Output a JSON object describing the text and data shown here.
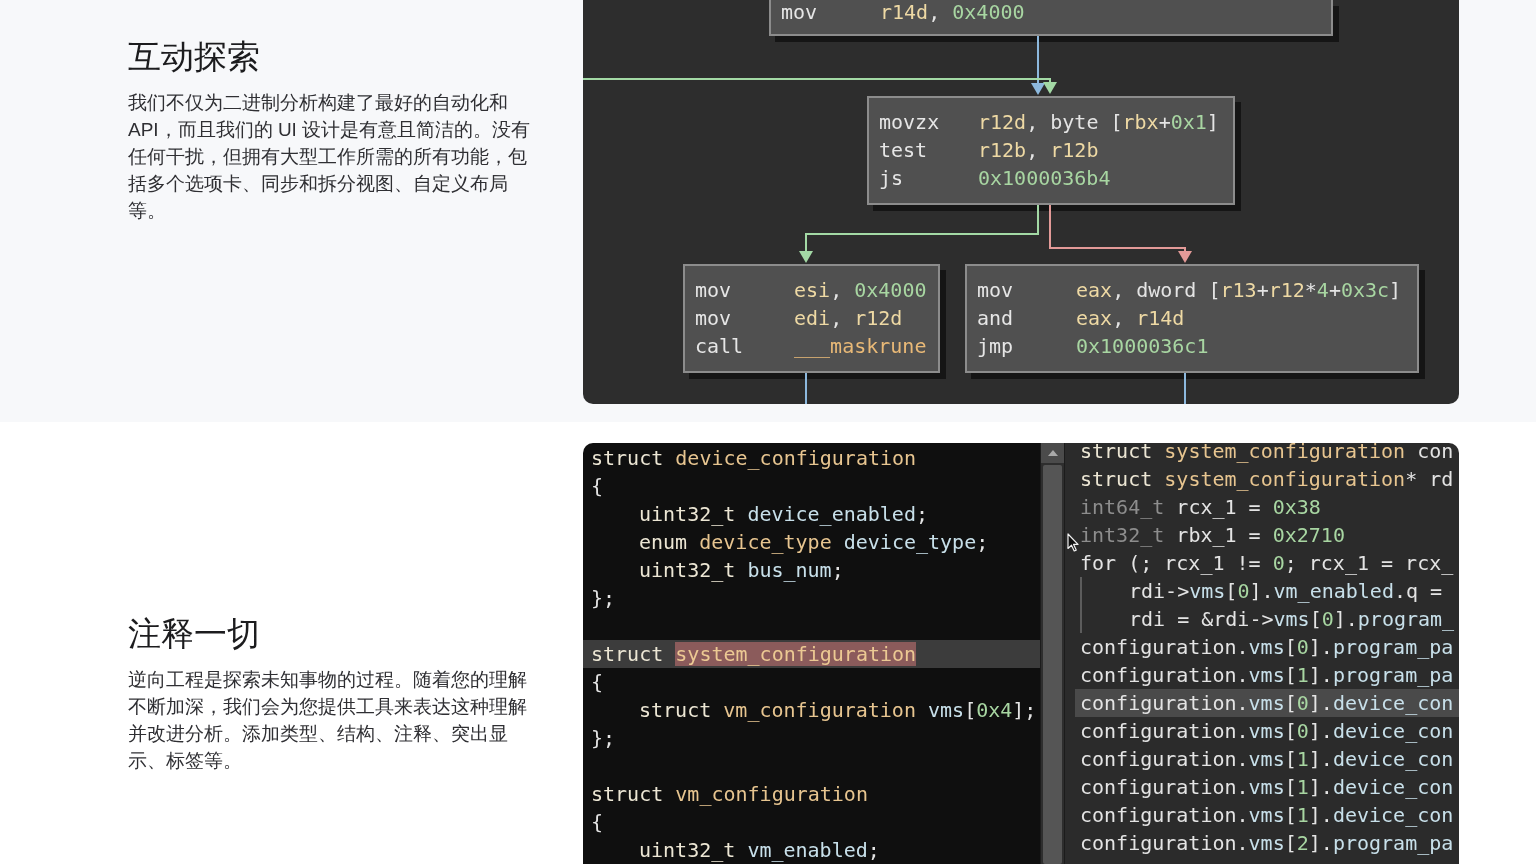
{
  "graph_section": {
    "heading": "互动探索",
    "description": "我们不仅为二进制分析构建了最好的自动化和API，而且我们的 UI 设计是有意且简洁的。没有任何干扰，但拥有大型工作所需的所有功能，包括多个选项卡、同步和拆分视图、自定义布局等。",
    "graph": {
      "blocks": [
        {
          "lines": [
            {
              "mnemonic": "mov",
              "operands": [
                {
                  "text": "r14d",
                  "kind": "register"
                },
                {
                  "text": ", ",
                  "kind": "plain"
                },
                {
                  "text": "0x4000",
                  "kind": "number"
                }
              ]
            }
          ]
        },
        {
          "lines": [
            {
              "mnemonic": "movzx",
              "operands": [
                {
                  "text": "r12d",
                  "kind": "register"
                },
                {
                  "text": ", byte [",
                  "kind": "plain"
                },
                {
                  "text": "rbx",
                  "kind": "register"
                },
                {
                  "text": "+",
                  "kind": "plain"
                },
                {
                  "text": "0x1",
                  "kind": "number"
                },
                {
                  "text": "]",
                  "kind": "plain"
                }
              ]
            },
            {
              "mnemonic": "test",
              "operands": [
                {
                  "text": "r12b",
                  "kind": "register"
                },
                {
                  "text": ", ",
                  "kind": "plain"
                },
                {
                  "text": "r12b",
                  "kind": "register"
                }
              ]
            },
            {
              "mnemonic": "js",
              "operands": [
                {
                  "text": "0x1000036b4",
                  "kind": "number"
                }
              ]
            }
          ]
        },
        {
          "lines": [
            {
              "mnemonic": "mov",
              "operands": [
                {
                  "text": "esi",
                  "kind": "register"
                },
                {
                  "text": ", ",
                  "kind": "plain"
                },
                {
                  "text": "0x4000",
                  "kind": "number"
                }
              ]
            },
            {
              "mnemonic": "mov",
              "operands": [
                {
                  "text": "edi",
                  "kind": "register"
                },
                {
                  "text": ", ",
                  "kind": "plain"
                },
                {
                  "text": "r12d",
                  "kind": "register"
                }
              ]
            },
            {
              "mnemonic": "call",
              "operands": [
                {
                  "text": "___maskrune",
                  "kind": "symbol"
                }
              ]
            }
          ]
        },
        {
          "lines": [
            {
              "mnemonic": "mov",
              "operands": [
                {
                  "text": "eax",
                  "kind": "register"
                },
                {
                  "text": ", dword [",
                  "kind": "plain"
                },
                {
                  "text": "r13",
                  "kind": "register"
                },
                {
                  "text": "+",
                  "kind": "plain"
                },
                {
                  "text": "r12",
                  "kind": "register"
                },
                {
                  "text": "*",
                  "kind": "plain"
                },
                {
                  "text": "4",
                  "kind": "number"
                },
                {
                  "text": "+",
                  "kind": "plain"
                },
                {
                  "text": "0x3c",
                  "kind": "number"
                },
                {
                  "text": "]",
                  "kind": "plain"
                }
              ]
            },
            {
              "mnemonic": "and",
              "operands": [
                {
                  "text": "eax",
                  "kind": "register"
                },
                {
                  "text": ", ",
                  "kind": "plain"
                },
                {
                  "text": "r14d",
                  "kind": "register"
                }
              ]
            },
            {
              "mnemonic": "jmp",
              "operands": [
                {
                  "text": "0x1000036c1",
                  "kind": "number"
                }
              ]
            }
          ]
        }
      ],
      "edges": [
        {
          "color": "#8db9de"
        },
        {
          "color": "#a3d9a5"
        },
        {
          "color": "#a3d9a5"
        },
        {
          "color": "#e39a98"
        },
        {
          "color": "#8db9de"
        },
        {
          "color": "#8db9de"
        }
      ]
    }
  },
  "types_section": {
    "heading": "注释一切",
    "description": "逆向工程是探索未知事物的过程。随着您的理解不断加深，我们会为您提供工具来表达这种理解并改进分析。添加类型、结构、注释、突出显示、标签等。",
    "types_pane": {
      "lines": [
        {
          "kind": "code",
          "selected": false,
          "tokens": [
            {
              "text": "struct ",
              "kind": "keyword"
            },
            {
              "text": "device_configuration",
              "kind": "type"
            }
          ]
        },
        {
          "kind": "code",
          "selected": false,
          "tokens": [
            {
              "text": "{",
              "kind": "plain"
            }
          ],
          "children": [
            {
              "kind": "code",
              "selected": false,
              "tokens": [
                {
                  "text": "uint32_t ",
                  "kind": "keyword"
                },
                {
                  "text": "device_enabled",
                  "kind": "field"
                },
                {
                  "text": ";",
                  "kind": "plain"
                }
              ]
            },
            {
              "kind": "code",
              "selected": false,
              "tokens": [
                {
                  "text": "enum ",
                  "kind": "keyword"
                },
                {
                  "text": "device_type ",
                  "kind": "type"
                },
                {
                  "text": "device_type",
                  "kind": "field"
                },
                {
                  "text": ";",
                  "kind": "plain"
                }
              ]
            },
            {
              "kind": "code",
              "selected": false,
              "tokens": [
                {
                  "text": "uint32_t ",
                  "kind": "keyword"
                },
                {
                  "text": "bus_num",
                  "kind": "field"
                },
                {
                  "text": ";",
                  "kind": "plain"
                }
              ]
            }
          ]
        },
        {
          "kind": "code",
          "selected": false,
          "tokens": [
            {
              "text": "};",
              "kind": "plain"
            }
          ]
        },
        {
          "kind": "blank",
          "selected": false
        },
        {
          "kind": "code",
          "selected": true,
          "tokens": [
            {
              "text": "struct ",
              "kind": "keyword"
            },
            {
              "text": "system_configuration",
              "kind": "match"
            }
          ]
        },
        {
          "kind": "code",
          "selected": false,
          "tokens": [
            {
              "text": "{",
              "kind": "plain"
            }
          ],
          "children": [
            {
              "kind": "code",
              "selected": false,
              "tokens": [
                {
                  "text": "struct ",
                  "kind": "keyword"
                },
                {
                  "text": "vm_configuration ",
                  "kind": "type"
                },
                {
                  "text": "vms",
                  "kind": "field"
                },
                {
                  "text": "[",
                  "kind": "plain"
                },
                {
                  "text": "0x4",
                  "kind": "number"
                },
                {
                  "text": "];",
                  "kind": "plain"
                }
              ]
            }
          ]
        },
        {
          "kind": "code",
          "selected": false,
          "tokens": [
            {
              "text": "};",
              "kind": "plain"
            }
          ]
        },
        {
          "kind": "blank",
          "selected": false
        },
        {
          "kind": "code",
          "selected": false,
          "tokens": [
            {
              "text": "struct ",
              "kind": "keyword"
            },
            {
              "text": "vm_configuration",
              "kind": "type"
            }
          ]
        },
        {
          "kind": "code",
          "selected": false,
          "tokens": [
            {
              "text": "{",
              "kind": "plain"
            }
          ],
          "children": [
            {
              "kind": "code",
              "selected": false,
              "tokens": [
                {
                  "text": "uint32_t ",
                  "kind": "keyword"
                },
                {
                  "text": "vm_enabled",
                  "kind": "field"
                },
                {
                  "text": ";",
                  "kind": "plain"
                }
              ]
            }
          ]
        }
      ]
    },
    "code_pane": {
      "indent_guides": true,
      "lines": [
        {
          "kind": "code",
          "selected": false,
          "tokens": [
            {
              "text": "struct ",
              "kind": "keyword"
            },
            {
              "text": "system_configuration",
              "kind": "type"
            },
            {
              "text": " con",
              "kind": "plain"
            }
          ]
        },
        {
          "kind": "code",
          "selected": false,
          "tokens": [
            {
              "text": "struct ",
              "kind": "keyword"
            },
            {
              "text": "system_configuration",
              "kind": "type"
            },
            {
              "text": "* rd",
              "kind": "plain"
            }
          ]
        },
        {
          "kind": "code",
          "selected": false,
          "tokens": [
            {
              "text": "int64_t",
              "kind": "dim"
            },
            {
              "text": " rcx_1 = ",
              "kind": "plain"
            },
            {
              "text": "0x38",
              "kind": "number"
            }
          ]
        },
        {
          "kind": "code",
          "selected": false,
          "tokens": [
            {
              "text": "int32_t",
              "kind": "dim"
            },
            {
              "text": " rbx_1 = ",
              "kind": "plain"
            },
            {
              "text": "0x2710",
              "kind": "number"
            }
          ]
        },
        {
          "kind": "code",
          "selected": false,
          "tokens": [
            {
              "text": "for (; rcx_1 != ",
              "kind": "plain"
            },
            {
              "text": "0",
              "kind": "number"
            },
            {
              "text": "; rcx_1 = rcx_",
              "kind": "plain"
            }
          ],
          "children": [
            {
              "kind": "code",
              "selected": false,
              "tokens": [
                {
                  "text": "rdi->",
                  "kind": "plain"
                },
                {
                  "text": "vms",
                  "kind": "field"
                },
                {
                  "text": "[",
                  "kind": "plain"
                },
                {
                  "text": "0",
                  "kind": "number"
                },
                {
                  "text": "].",
                  "kind": "plain"
                },
                {
                  "text": "vm_enabled",
                  "kind": "field"
                },
                {
                  "text": ".q =",
                  "kind": "plain"
                }
              ]
            },
            {
              "kind": "code",
              "selected": false,
              "tokens": [
                {
                  "text": "rdi = &rdi->",
                  "kind": "plain"
                },
                {
                  "text": "vms",
                  "kind": "field"
                },
                {
                  "text": "[",
                  "kind": "plain"
                },
                {
                  "text": "0",
                  "kind": "number"
                },
                {
                  "text": "].",
                  "kind": "plain"
                },
                {
                  "text": "program_",
                  "kind": "field"
                }
              ]
            }
          ]
        },
        {
          "kind": "code",
          "selected": false,
          "tokens": [
            {
              "text": "configuration.",
              "kind": "plain"
            },
            {
              "text": "vms",
              "kind": "field"
            },
            {
              "text": "[",
              "kind": "plain"
            },
            {
              "text": "0",
              "kind": "number"
            },
            {
              "text": "].",
              "kind": "plain"
            },
            {
              "text": "program_pa",
              "kind": "field"
            }
          ]
        },
        {
          "kind": "code",
          "selected": false,
          "tokens": [
            {
              "text": "configuration.",
              "kind": "plain"
            },
            {
              "text": "vms",
              "kind": "field"
            },
            {
              "text": "[",
              "kind": "plain"
            },
            {
              "text": "1",
              "kind": "number"
            },
            {
              "text": "].",
              "kind": "plain"
            },
            {
              "text": "program_pa",
              "kind": "field"
            }
          ]
        },
        {
          "kind": "code",
          "selected": true,
          "tokens": [
            {
              "text": "configuration.",
              "kind": "plain"
            },
            {
              "text": "vms",
              "kind": "field"
            },
            {
              "text": "[",
              "kind": "plain"
            },
            {
              "text": "0",
              "kind": "number"
            },
            {
              "text": "].",
              "kind": "plain"
            },
            {
              "text": "device_con",
              "kind": "field"
            }
          ]
        },
        {
          "kind": "code",
          "selected": false,
          "tokens": [
            {
              "text": "configuration.",
              "kind": "plain"
            },
            {
              "text": "vms",
              "kind": "field"
            },
            {
              "text": "[",
              "kind": "plain"
            },
            {
              "text": "0",
              "kind": "number"
            },
            {
              "text": "].",
              "kind": "plain"
            },
            {
              "text": "device_con",
              "kind": "field"
            }
          ]
        },
        {
          "kind": "code",
          "selected": false,
          "tokens": [
            {
              "text": "configuration.",
              "kind": "plain"
            },
            {
              "text": "vms",
              "kind": "field"
            },
            {
              "text": "[",
              "kind": "plain"
            },
            {
              "text": "1",
              "kind": "number"
            },
            {
              "text": "].",
              "kind": "plain"
            },
            {
              "text": "device_con",
              "kind": "field"
            }
          ]
        },
        {
          "kind": "code",
          "selected": false,
          "tokens": [
            {
              "text": "configuration.",
              "kind": "plain"
            },
            {
              "text": "vms",
              "kind": "field"
            },
            {
              "text": "[",
              "kind": "plain"
            },
            {
              "text": "1",
              "kind": "number"
            },
            {
              "text": "].",
              "kind": "plain"
            },
            {
              "text": "device_con",
              "kind": "field"
            }
          ]
        },
        {
          "kind": "code",
          "selected": false,
          "tokens": [
            {
              "text": "configuration.",
              "kind": "plain"
            },
            {
              "text": "vms",
              "kind": "field"
            },
            {
              "text": "[",
              "kind": "plain"
            },
            {
              "text": "1",
              "kind": "number"
            },
            {
              "text": "].",
              "kind": "plain"
            },
            {
              "text": "device_con",
              "kind": "field"
            }
          ]
        },
        {
          "kind": "code",
          "selected": false,
          "tokens": [
            {
              "text": "configuration.",
              "kind": "plain"
            },
            {
              "text": "vms",
              "kind": "field"
            },
            {
              "text": "[",
              "kind": "plain"
            },
            {
              "text": "2",
              "kind": "number"
            },
            {
              "text": "].",
              "kind": "plain"
            },
            {
              "text": "program_pa",
              "kind": "field"
            }
          ]
        }
      ]
    }
  }
}
